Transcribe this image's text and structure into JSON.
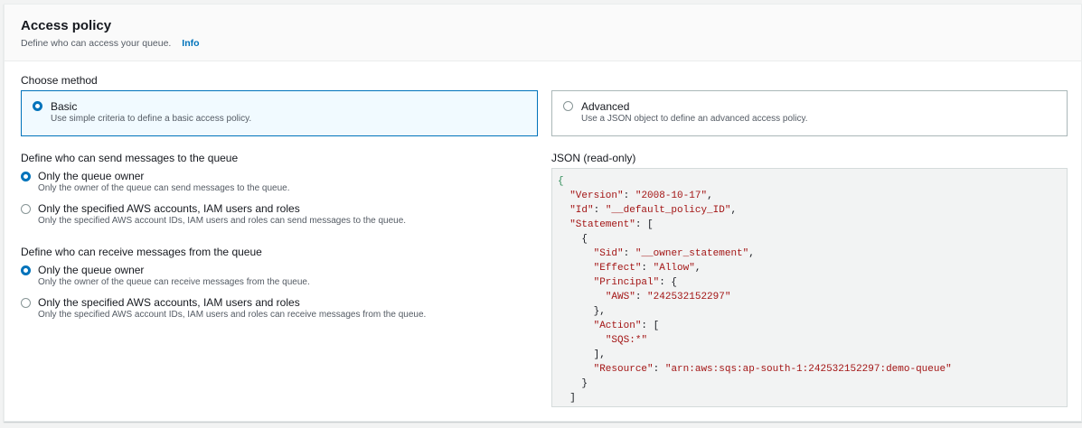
{
  "header": {
    "title": "Access policy",
    "subtitle": "Define who can access your queue.",
    "info_link": "Info"
  },
  "choose_method": {
    "label": "Choose method",
    "options": [
      {
        "label": "Basic",
        "description": "Use simple criteria to define a basic access policy.",
        "selected": true
      },
      {
        "label": "Advanced",
        "description": "Use a JSON object to define an advanced access policy.",
        "selected": false
      }
    ]
  },
  "send": {
    "label": "Define who can send messages to the queue",
    "options": [
      {
        "label": "Only the queue owner",
        "description": "Only the owner of the queue can send messages to the queue.",
        "selected": true
      },
      {
        "label": "Only the specified AWS accounts, IAM users and roles",
        "description": "Only the specified AWS account IDs, IAM users and roles can send messages to the queue.",
        "selected": false
      }
    ]
  },
  "receive": {
    "label": "Define who can receive messages from the queue",
    "options": [
      {
        "label": "Only the queue owner",
        "description": "Only the owner of the queue can receive messages from the queue.",
        "selected": true
      },
      {
        "label": "Only the specified AWS accounts, IAM users and roles",
        "description": "Only the specified AWS account IDs, IAM users and roles can receive messages from the queue.",
        "selected": false
      }
    ]
  },
  "json_panel": {
    "label": "JSON (read-only)",
    "version": "2008-10-17",
    "id": "__default_policy_ID",
    "sid": "__owner_statement",
    "effect": "Allow",
    "aws_principal": "242532152297",
    "action": "SQS:*",
    "resource": "arn:aws:sqs:ap-south-1:242532152297:demo-queue"
  },
  "colors": {
    "accent": "#0073bb",
    "selected_tile_bg": "#f1faff",
    "json_key": "#a31515",
    "json_brace": "#2e8b57"
  }
}
